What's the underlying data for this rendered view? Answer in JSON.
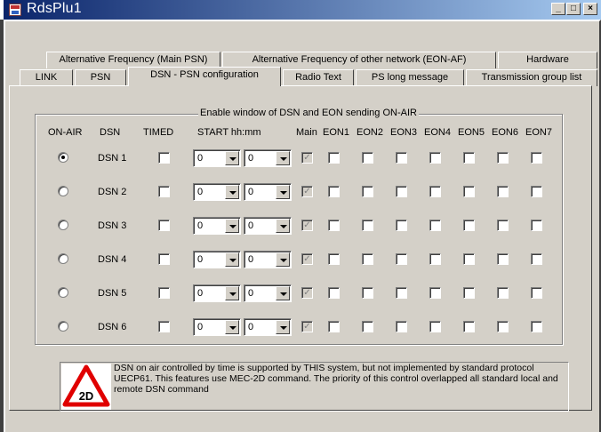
{
  "window": {
    "title": "RdsPlu1",
    "controls": {
      "minimize": "_",
      "maximize": "□",
      "close": "×"
    }
  },
  "tabs": {
    "row1": [
      {
        "label": "Alternative Frequency (Main PSN)"
      },
      {
        "label": "Alternative Frequency of other network (EON-AF)"
      },
      {
        "label": "Hardware"
      }
    ],
    "row2": [
      {
        "label": "LINK"
      },
      {
        "label": "PSN"
      },
      {
        "label": "DSN - PSN configuration",
        "active": true
      },
      {
        "label": "Radio Text"
      },
      {
        "label": "PS long message"
      },
      {
        "label": "Transmission group list"
      }
    ]
  },
  "group": {
    "title": "Enable window of DSN and EON sending ON-AIR",
    "headers": {
      "on_air": "ON-AIR",
      "dsn": "DSN",
      "timed": "TIMED",
      "start": "START hh:mm",
      "main": "Main",
      "eon1": "EON1",
      "eon2": "EON2",
      "eon3": "EON3",
      "eon4": "EON4",
      "eon5": "EON5",
      "eon6": "EON6",
      "eon7": "EON7"
    },
    "rows": [
      {
        "dsn": "DSN 1",
        "on_air": true,
        "timed": false,
        "hh": "0",
        "mm": "0",
        "main": true
      },
      {
        "dsn": "DSN 2",
        "on_air": false,
        "timed": false,
        "hh": "0",
        "mm": "0",
        "main": true
      },
      {
        "dsn": "DSN 3",
        "on_air": false,
        "timed": false,
        "hh": "0",
        "mm": "0",
        "main": true
      },
      {
        "dsn": "DSN 4",
        "on_air": false,
        "timed": false,
        "hh": "0",
        "mm": "0",
        "main": true
      },
      {
        "dsn": "DSN 5",
        "on_air": false,
        "timed": false,
        "hh": "0",
        "mm": "0",
        "main": true
      },
      {
        "dsn": "DSN 6",
        "on_air": false,
        "timed": false,
        "hh": "0",
        "mm": "0",
        "main": true
      }
    ]
  },
  "note": {
    "icon_label": "2D",
    "text": "DSN on air controlled by time is supported by THIS system, but not implemented by standard protocol UECP61. This features use MEC-2D command. The priority of this control overlapped all standard local and remote DSN command"
  },
  "colors": {
    "face": "#d4d0c8",
    "title_start": "#0a246a",
    "title_end": "#a6caf0",
    "warning_red": "#e00000"
  }
}
